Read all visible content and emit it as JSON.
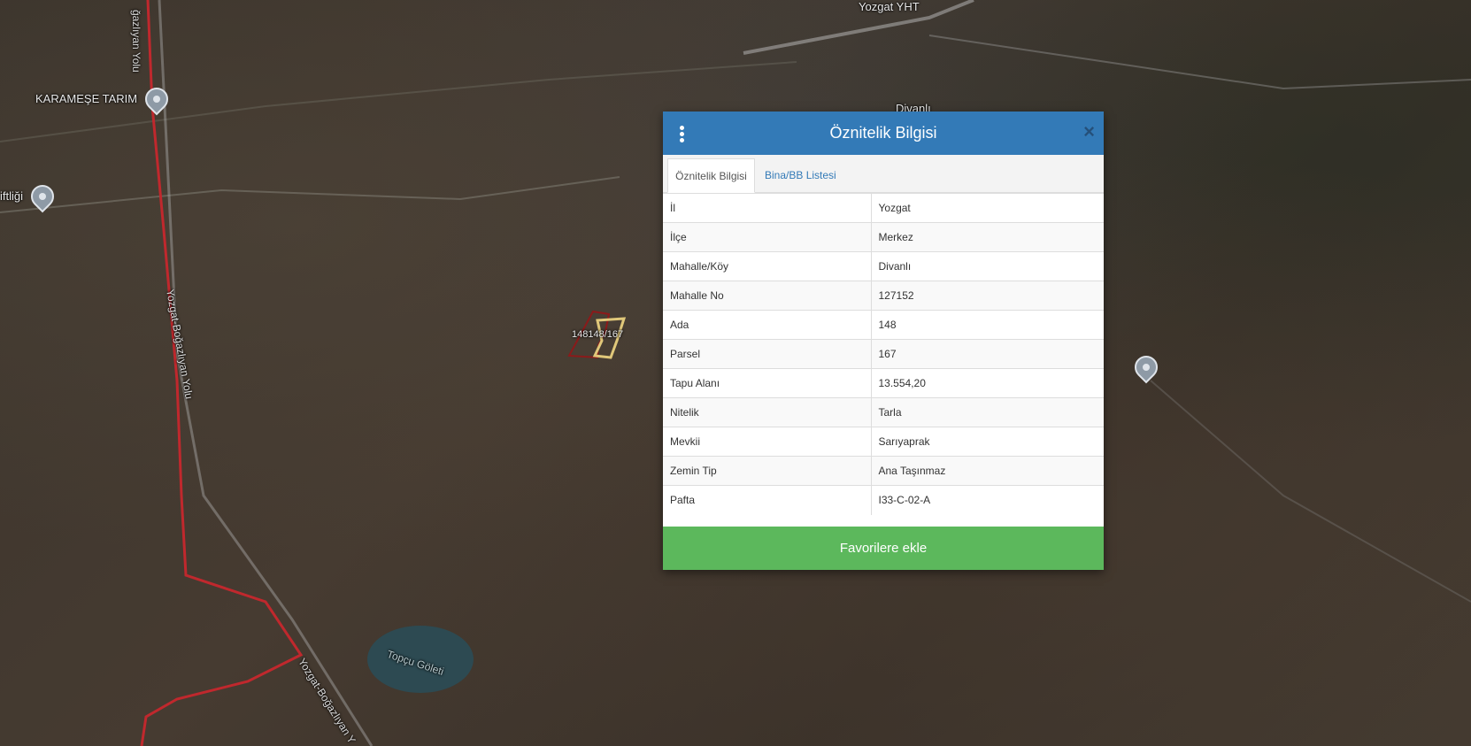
{
  "map": {
    "labels": {
      "karamese": "KARAMEŞE TARIM",
      "ciftligi": "iftliği",
      "yozgat_yht": "Yozgat YHT",
      "divanli": "Divanlı",
      "topcu_goleti": "Topçu Göleti",
      "parcel": "148148/167"
    },
    "road_labels": {
      "road_top": "ğazlıyan Yolu",
      "road_mid": "Yozgat-Boğazlıyan Yolu",
      "road_bottom": "Yozgat-Boğazlıyan Y"
    },
    "colors": {
      "road_red": "#c0282d",
      "parcel_red": "#8b1a1a",
      "parcel_yellow": "#e0c87a",
      "lake": "#2d4a52"
    }
  },
  "modal": {
    "title": "Öznitelik Bilgisi",
    "menu_icon": "kebab-menu-icon",
    "close_icon": "×",
    "tabs": [
      {
        "label": "Öznitelik Bilgisi"
      },
      {
        "label": "Bina/BB Listesi"
      }
    ],
    "rows": [
      {
        "key": "İl",
        "value": "Yozgat"
      },
      {
        "key": "İlçe",
        "value": "Merkez"
      },
      {
        "key": "Mahalle/Köy",
        "value": "Divanlı"
      },
      {
        "key": "Mahalle No",
        "value": "127152"
      },
      {
        "key": "Ada",
        "value": "148"
      },
      {
        "key": "Parsel",
        "value": "167"
      },
      {
        "key": "Tapu Alanı",
        "value": "13.554,20"
      },
      {
        "key": "Nitelik",
        "value": "Tarla"
      },
      {
        "key": "Mevkii",
        "value": "Sarıyaprak"
      },
      {
        "key": "Zemin Tip",
        "value": "Ana Taşınmaz"
      },
      {
        "key": "Pafta",
        "value": "I33-C-02-A"
      }
    ],
    "favorite_button": "Favorilere ekle",
    "colors": {
      "header": "#337ab7",
      "button": "#5cb85c"
    }
  }
}
